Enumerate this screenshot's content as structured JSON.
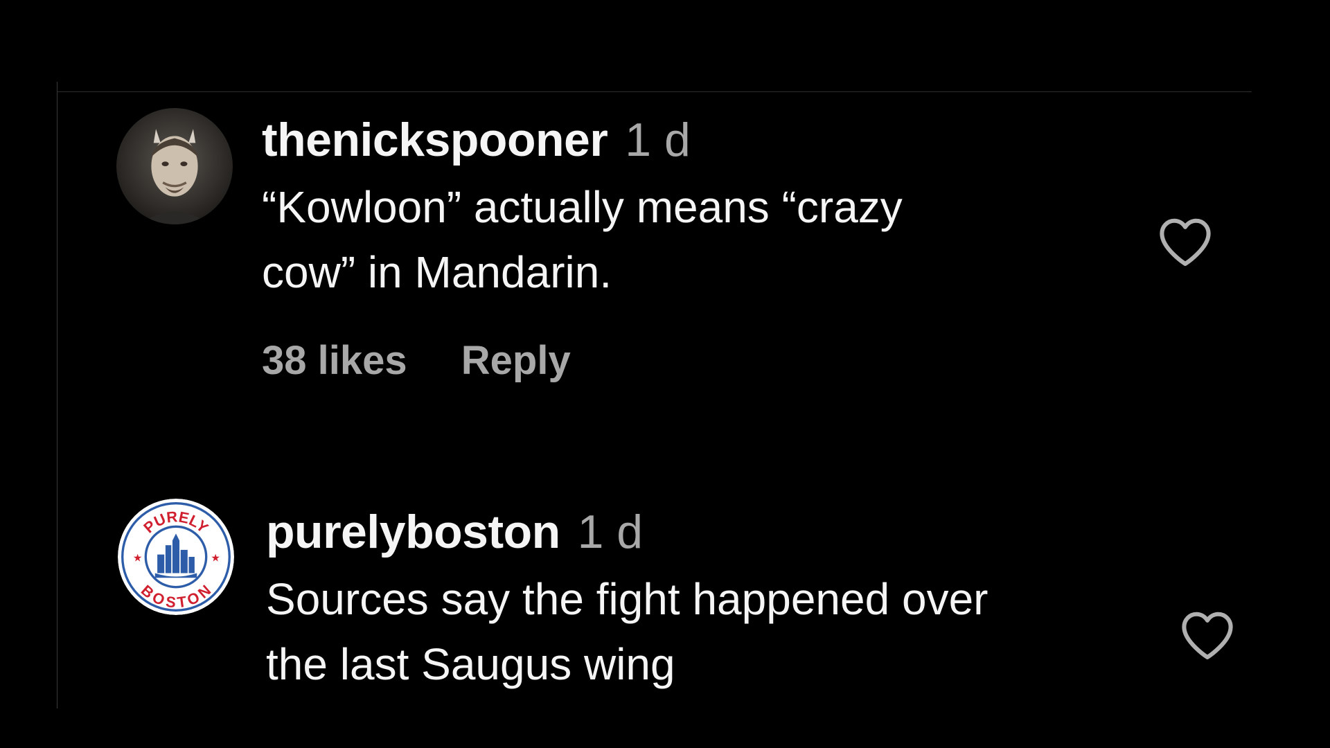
{
  "comments": [
    {
      "username": "thenickspooner",
      "time": "1 d",
      "text_lines": [
        "“Kowloon” actually means “crazy",
        "cow” in Mandarin."
      ],
      "likes": "38 likes",
      "reply": "Reply",
      "avatar": "user-photo-avatar",
      "like_icon": "heart-outline-icon"
    },
    {
      "username": "purelyboston",
      "time": "1 d",
      "text_lines": [
        "Sources say the fight happened over",
        "the last Saugus wing"
      ],
      "avatar": "purely-boston-logo",
      "avatar_text_top": "PURELY",
      "avatar_text_bottom": "BOSTON",
      "like_icon": "heart-outline-icon"
    }
  ],
  "colors": {
    "background": "#000000",
    "primary_text": "#f5f5f5",
    "secondary_text": "#a8a8a8",
    "divider": "#2f2f2f",
    "logo_red": "#d0202f",
    "logo_blue": "#2d5da8"
  }
}
